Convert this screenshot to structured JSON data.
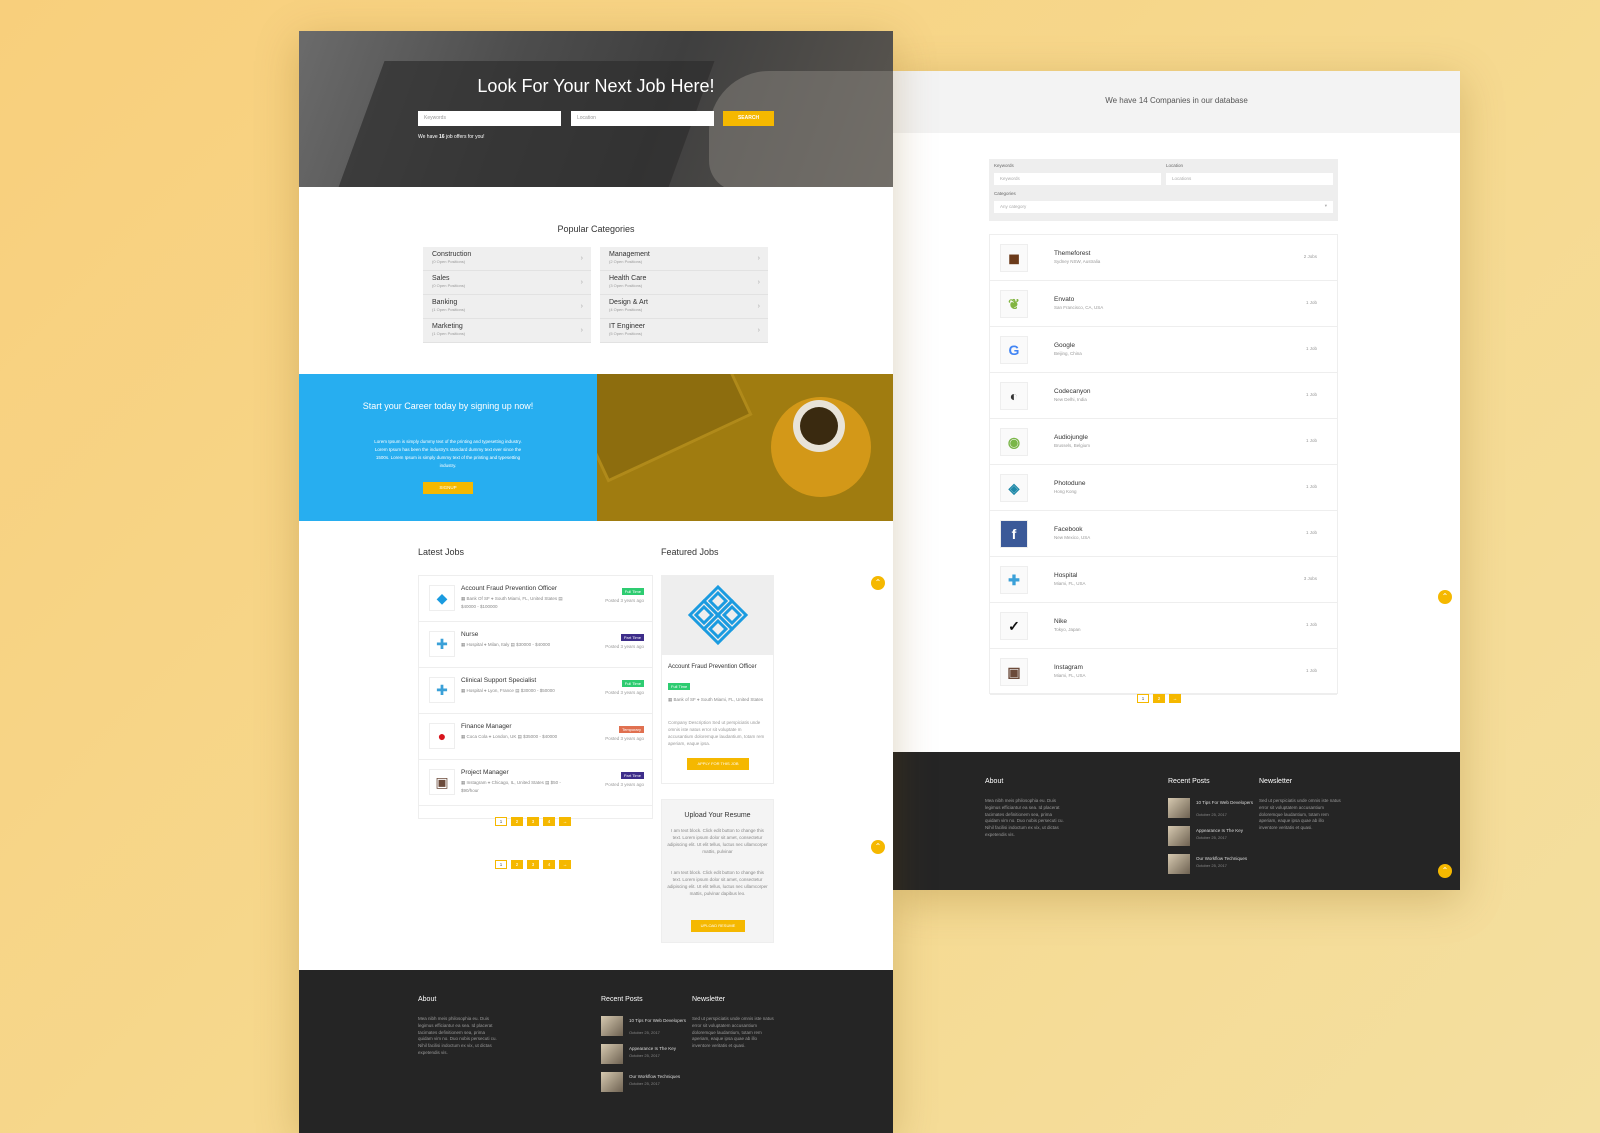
{
  "colors": {
    "accent": "#f5b800",
    "blue": "#27aef0",
    "full_time": "#2ecc71",
    "part_time": "#3d2d8a",
    "temporary": "#e07050",
    "footer": "#252525"
  },
  "left_page": {
    "hero": {
      "title": "Look For Your Next Job Here!",
      "keywords_placeholder": "Keywords",
      "location_placeholder": "Location",
      "search_label": "SEARCH",
      "offers_prefix": "We have ",
      "offers_count": "16",
      "offers_suffix": " job offers for you!"
    },
    "popular": {
      "title": "Popular Categories",
      "items": [
        {
          "name": "Construction",
          "count": "(0 Open Positions)"
        },
        {
          "name": "Management",
          "count": "(2 Open Positions)"
        },
        {
          "name": "Sales",
          "count": "(0 Open Positions)"
        },
        {
          "name": "Health Care",
          "count": "(3 Open Positions)"
        },
        {
          "name": "Banking",
          "count": "(1 Open Positions)"
        },
        {
          "name": "Design & Art",
          "count": "(4 Open Positions)"
        },
        {
          "name": "Marketing",
          "count": "(1 Open Positions)"
        },
        {
          "name": "IT Engineer",
          "count": "(5 Open Positions)"
        }
      ]
    },
    "career": {
      "title": "Start your Career today by signing up now!",
      "text": "Lorem Ipsum is simply dummy text of the printing and typesetting industry. Lorem Ipsum has been the industry's standard dummy text ever since the 1500s. Lorem Ipsum is simply dummy text of the printing and typesetting industry.",
      "button": "SIGNUP"
    },
    "latest": {
      "title": "Latest Jobs",
      "jobs": [
        {
          "title": "Account Fraud Prevention Officer",
          "company": "Bank Of SF",
          "location": "South Miami, FL, United States",
          "salary": "$40000 - $100000",
          "badge": "Full Time",
          "posted": "Posted 3 years ago",
          "icon": "diamond-logo-icon"
        },
        {
          "title": "Nurse",
          "company": "Hospital",
          "location": "Milan, Italy",
          "salary": "$30000 - $40000",
          "badge": "Part Time",
          "posted": "Posted 3 years ago",
          "icon": "cross-logo-icon"
        },
        {
          "title": "Clinical Support Specialist",
          "company": "Hospital",
          "location": "Lyon, France",
          "salary": "$30000 - $50000",
          "badge": "Full Time",
          "posted": "Posted 3 years ago",
          "icon": "cross-logo-icon"
        },
        {
          "title": "Finance Manager",
          "company": "Coca Cola",
          "location": "London, UK",
          "salary": "$35000 - $40000",
          "badge": "Temporary",
          "posted": "Posted 3 years ago",
          "icon": "coca-cola-logo-icon"
        },
        {
          "title": "Project Manager",
          "company": "Instagram",
          "location": "Chicago, IL, United States",
          "salary": "$50 - $90/hour",
          "badge": "Part Time",
          "posted": "Posted 3 years ago",
          "icon": "instagram-logo-icon"
        }
      ],
      "pages": [
        "1",
        "2",
        "3",
        "4",
        "→"
      ]
    },
    "featured": {
      "title": "Featured Jobs",
      "job_title": "Account Fraud Prevention Officer",
      "badge": "Full Time",
      "company": "Bank of SF",
      "location": "South Miami, FL, United States",
      "desc": "Company Description Sed ut perspiciatis unde omnis iste natus error sit voluptate m accusantium doloremque laudantium, totam rem aperiam, eaque ipsa.",
      "button": "APPLY FOR THIS JOB"
    },
    "resume": {
      "title": "Upload Your Resume",
      "text1": "I am text block. Click edit button to change this text. Lorem ipsum dolor sit amet, consectetur adipiscing elit. Ut elit tellus, luctus nec ullamcorper mattis, pulvinar",
      "text2": "I am text block. Click edit button to change this text. Lorem ipsum dolor sit amet, consectetur adipiscing elit. Ut elit tellus, luctus nec ullamcorper mattis, pulvinar dapibus leo.",
      "button": "UPLOAD RESUME"
    },
    "footer": {
      "about_title": "About",
      "about_text": "Mea nibh meis philosophia eu. Duis legimus efficiantur ea sea. Id placerat tacimates definitionem sea, prima quidam vim no. Duo nobis persecuti cu. Nihil facilisi indoctum ex vix, ut dictas expetendis vis.",
      "posts_title": "Recent Posts",
      "posts": [
        {
          "title": "10 Tips For Web Developers",
          "date": "October 25, 2017"
        },
        {
          "title": "Appearance Is The Key",
          "date": "October 25, 2017"
        },
        {
          "title": "Our Workflow Techniques",
          "date": "October 25, 2017"
        }
      ],
      "newsletter_title": "Newsletter",
      "newsletter_text": "Sed ut perspiciatis unde omnis iste natus error sit voluptatem accusantium doloremque laudantium, totam rem aperiam, eaque ipsa quae ab illo inventore veritatis et quasi."
    }
  },
  "right_page": {
    "banner": "We have 14 Companies in our database",
    "filters": {
      "keywords_label": "Keywords",
      "keywords_placeholder": "Keywords",
      "location_label": "Location",
      "location_placeholder": "Locations",
      "categories_label": "Categories",
      "categories_value": "Any category"
    },
    "companies": [
      {
        "name": "Themeforest",
        "location": "Sydney NSW, Australia",
        "jobs": "2 Jobs",
        "icon": "themeforest-logo-icon"
      },
      {
        "name": "Envato",
        "location": "San Francisco, CA, USA",
        "jobs": "1 Job",
        "icon": "envato-logo-icon"
      },
      {
        "name": "Google",
        "location": "Beijing, China",
        "jobs": "1 Job",
        "icon": "google-logo-icon"
      },
      {
        "name": "Codecanyon",
        "location": "New Delhi, India",
        "jobs": "1 Job",
        "icon": "codecanyon-logo-icon"
      },
      {
        "name": "Audiojungle",
        "location": "Brussels, Belgium",
        "jobs": "1 Job",
        "icon": "audiojungle-logo-icon"
      },
      {
        "name": "Photodune",
        "location": "Hong Kong",
        "jobs": "1 Job",
        "icon": "photodune-logo-icon"
      },
      {
        "name": "Facebook",
        "location": "New Mexico, USA",
        "jobs": "1 Job",
        "icon": "facebook-logo-icon"
      },
      {
        "name": "Hospital",
        "location": "Miami, FL, USA",
        "jobs": "3 Jobs",
        "icon": "hospital-logo-icon"
      },
      {
        "name": "Nike",
        "location": "Tokyo, Japan",
        "jobs": "1 Job",
        "icon": "nike-logo-icon"
      },
      {
        "name": "Instagram",
        "location": "Miami, FL, USA",
        "jobs": "1 Job",
        "icon": "instagram-logo-icon"
      }
    ],
    "pages": [
      "1",
      "2",
      "→"
    ],
    "footer": {
      "about_title": "About",
      "about_text": "Mea nibh meis philosophia eu. Duis legimus efficiantur ea sea. Id placerat tacimates definitionem sea, prima quidam vim no. Duo nobis persecuti cu. Nihil facilisi indoctum ex vix, ut dictas expetendis vis.",
      "posts_title": "Recent Posts",
      "posts": [
        {
          "title": "10 Tips For Web Developers",
          "date": "October 25, 2017"
        },
        {
          "title": "Appearance Is The Key",
          "date": "October 25, 2017"
        },
        {
          "title": "Our Workflow Techniques",
          "date": "October 25, 2017"
        }
      ],
      "newsletter_title": "Newsletter",
      "newsletter_text": "Sed ut perspiciatis unde omnis iste natus error sit voluptatem accusantium doloremque laudantium, totam rem aperiam, eaque ipsa quae ab illo inventore veritatis et quasi."
    }
  }
}
